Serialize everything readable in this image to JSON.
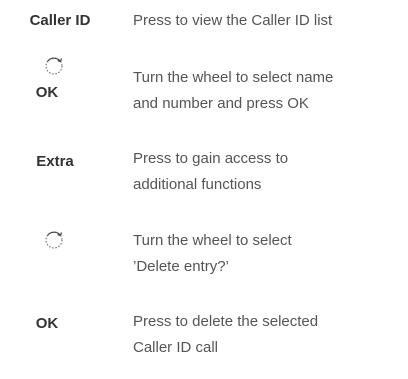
{
  "steps": [
    {
      "key": "Caller ID",
      "lines": [
        "Press to view the Caller ID list"
      ]
    },
    {
      "icon": "wheel-icon",
      "key": "OK",
      "lines": [
        "Turn the wheel to select name",
        "and number and press OK"
      ]
    },
    {
      "key": "Extra",
      "lines": [
        "Press to gain access to",
        "additional functions"
      ]
    },
    {
      "icon": "wheel-icon",
      "lines": [
        "Turn the wheel to select",
        "’Delete entry?’"
      ]
    },
    {
      "key": "OK",
      "lines": [
        "Press to delete the selected",
        "Caller ID call"
      ]
    }
  ]
}
